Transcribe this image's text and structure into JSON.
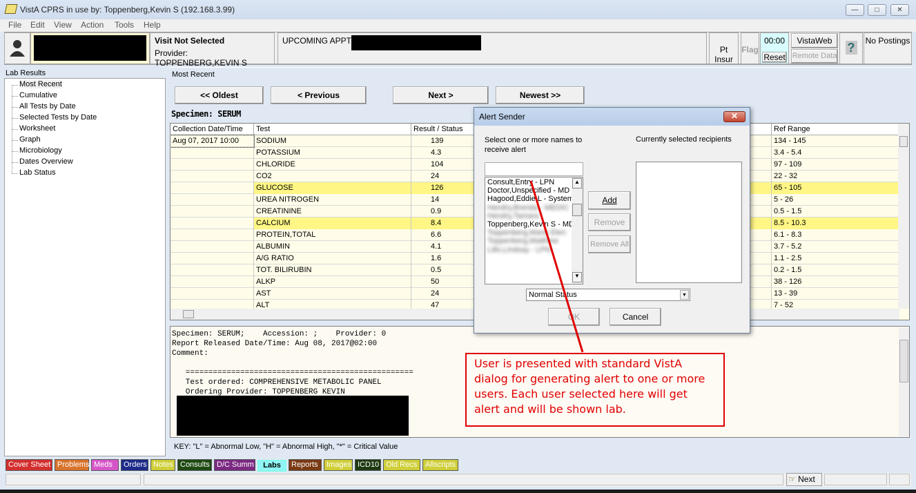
{
  "window": {
    "title": "VistA CPRS in use by: Toppenberg,Kevin S  (192.168.3.99)",
    "controls": {
      "minimize": "—",
      "maximize": "□",
      "close": "✕"
    }
  },
  "menu": [
    "File",
    "Edit",
    "View",
    "Action",
    "Tools",
    "Help"
  ],
  "patient_bar": {
    "visit_title": "Visit Not Selected",
    "provider": "Provider:  TOPPENBERG,KEVIN S",
    "upcoming_appts_label": "UPCOMING APPTS:",
    "pt_insur": "Pt Insur",
    "flag": "Flag",
    "timer": "00:00",
    "reset": "Reset",
    "vistaweb": "VistaWeb",
    "remote_data": "Remote Data",
    "help_glyph": "?",
    "postings": "No Postings"
  },
  "sidebar": {
    "label": "Lab Results",
    "items": [
      "Most Recent",
      "Cumulative",
      "All Tests by Date",
      "Selected Tests by Date",
      "Worksheet",
      "Graph",
      "Microbiology",
      "Dates Overview",
      "Lab Status"
    ],
    "selected": "Most Recent"
  },
  "main": {
    "view_label": "Most Recent",
    "nav": {
      "oldest": "<< Oldest",
      "previous": "< Previous",
      "next": "Next >",
      "newest": "Newest >>"
    },
    "specimen": "Specimen: SERUM",
    "columns": {
      "date": "Collection Date/Time",
      "test": "Test",
      "result": "Result / Status",
      "ref": "Ref Range"
    },
    "collection_date": "Aug 07, 2017 10:00",
    "rows": [
      {
        "test": "SODIUM",
        "result": "139",
        "ref": "134 - 145",
        "flag": false
      },
      {
        "test": "POTASSIUM",
        "result": "4.3",
        "ref": "3.4 - 5.4",
        "flag": false
      },
      {
        "test": "CHLORIDE",
        "result": "104",
        "ref": "97 - 109",
        "flag": false
      },
      {
        "test": "CO2",
        "result": "24",
        "ref": "22 - 32",
        "flag": false
      },
      {
        "test": "GLUCOSE",
        "result": "126",
        "ref": "65 - 105",
        "flag": true
      },
      {
        "test": "UREA NITROGEN",
        "result": "14",
        "ref": "5 - 26",
        "flag": false
      },
      {
        "test": "CREATININE",
        "result": "0.9",
        "ref": "0.5 - 1.5",
        "flag": false
      },
      {
        "test": "CALCIUM",
        "result": "8.4",
        "ref": "8.5 - 10.3",
        "flag": true
      },
      {
        "test": "PROTEIN,TOTAL",
        "result": "6.6",
        "ref": "6.1 - 8.3",
        "flag": false
      },
      {
        "test": "ALBUMIN",
        "result": "4.1",
        "ref": "3.7 - 5.2",
        "flag": false
      },
      {
        "test": "A/G RATIO",
        "result": "1.6",
        "ref": "1.1 - 2.5",
        "flag": false
      },
      {
        "test": "TOT. BILIRUBIN",
        "result": "0.5",
        "ref": "0.2 - 1.5",
        "flag": false
      },
      {
        "test": "ALKP",
        "result": "50",
        "ref": "38 - 126",
        "flag": false
      },
      {
        "test": "AST",
        "result": "24",
        "ref": "13 - 39",
        "flag": false
      },
      {
        "test": "ALT",
        "result": "47",
        "ref": "7 - 52",
        "flag": false
      }
    ],
    "highlight_color": "#fff685",
    "report_lines": [
      "Specimen: SERUM;    Accession: ;    Provider: 0",
      "Report Released Date/Time: Aug 08, 2017@02:00",
      "Comment:",
      "",
      "   ==================================================",
      "   Test ordered: COMPREHENSIVE METABOLIC PANEL",
      "   Ordering Provider: TOPPENBERG KEVIN"
    ],
    "key": "KEY: \"L\" = Abnormal Low, \"H\" = Abnormal High, \"*\" = Critical Value"
  },
  "tabs": [
    {
      "label": "Cover Sheet",
      "bg": "#d32f2f",
      "fg": "#ffffff"
    },
    {
      "label": "Problems",
      "bg": "#d9742c",
      "fg": "#ffffff"
    },
    {
      "label": "Meds",
      "bg": "#d656c9",
      "fg": "#ffffff"
    },
    {
      "label": "Orders",
      "bg": "#1c2a8a",
      "fg": "#ffffff"
    },
    {
      "label": "Notes",
      "bg": "#cfcf3a",
      "fg": "#ffffff"
    },
    {
      "label": "Consults",
      "bg": "#1e4a12",
      "fg": "#ffffff"
    },
    {
      "label": "D/C Summ",
      "bg": "#7b2a82",
      "fg": "#ffffff"
    },
    {
      "label": "Labs",
      "bg": "#8ff5f5",
      "fg": "#000000",
      "active": true
    },
    {
      "label": "Reports",
      "bg": "#7a3a14",
      "fg": "#ffffff"
    },
    {
      "label": "Images",
      "bg": "#cfcf3a",
      "fg": "#ffffff"
    },
    {
      "label": "ICD10",
      "bg": "#1e3a12",
      "fg": "#ffffff"
    },
    {
      "label": "Old Recs",
      "bg": "#cfcf3a",
      "fg": "#ffffff"
    },
    {
      "label": "Allscripts",
      "bg": "#cfcf3a",
      "fg": "#ffffff"
    }
  ],
  "statusbar": {
    "next": "Next"
  },
  "dialog": {
    "title": "Alert Sender",
    "close": "✕",
    "instruction": "Select one or more names to receive alert",
    "recipients_label": "Currently selected recipients",
    "search_value": "",
    "names": [
      "Consult,Entry - LPN",
      "Doctor,Unspecified - MD",
      "Hagood,Eddie L - System",
      "Hendry,Brenda - MEDIC",
      "Hendry,Tamara",
      "Toppenberg,Kevin S - MD",
      "Toppenberg,Marie Elen",
      "Toppenberg,Matthew",
      "Lillo,Lindsay - LPN"
    ],
    "blurred": [
      false,
      false,
      false,
      true,
      true,
      false,
      true,
      true,
      true
    ],
    "add": "Add",
    "remove": "Remove",
    "remove_all": "Remove All",
    "status_value": "Normal Status",
    "ok": "OK",
    "cancel": "Cancel"
  },
  "annotation": {
    "text": "User is presented with standard VistA dialog for generating alert to one or more users.   Each user selected here will get alert and will be shown lab.",
    "color": "#e00000"
  }
}
